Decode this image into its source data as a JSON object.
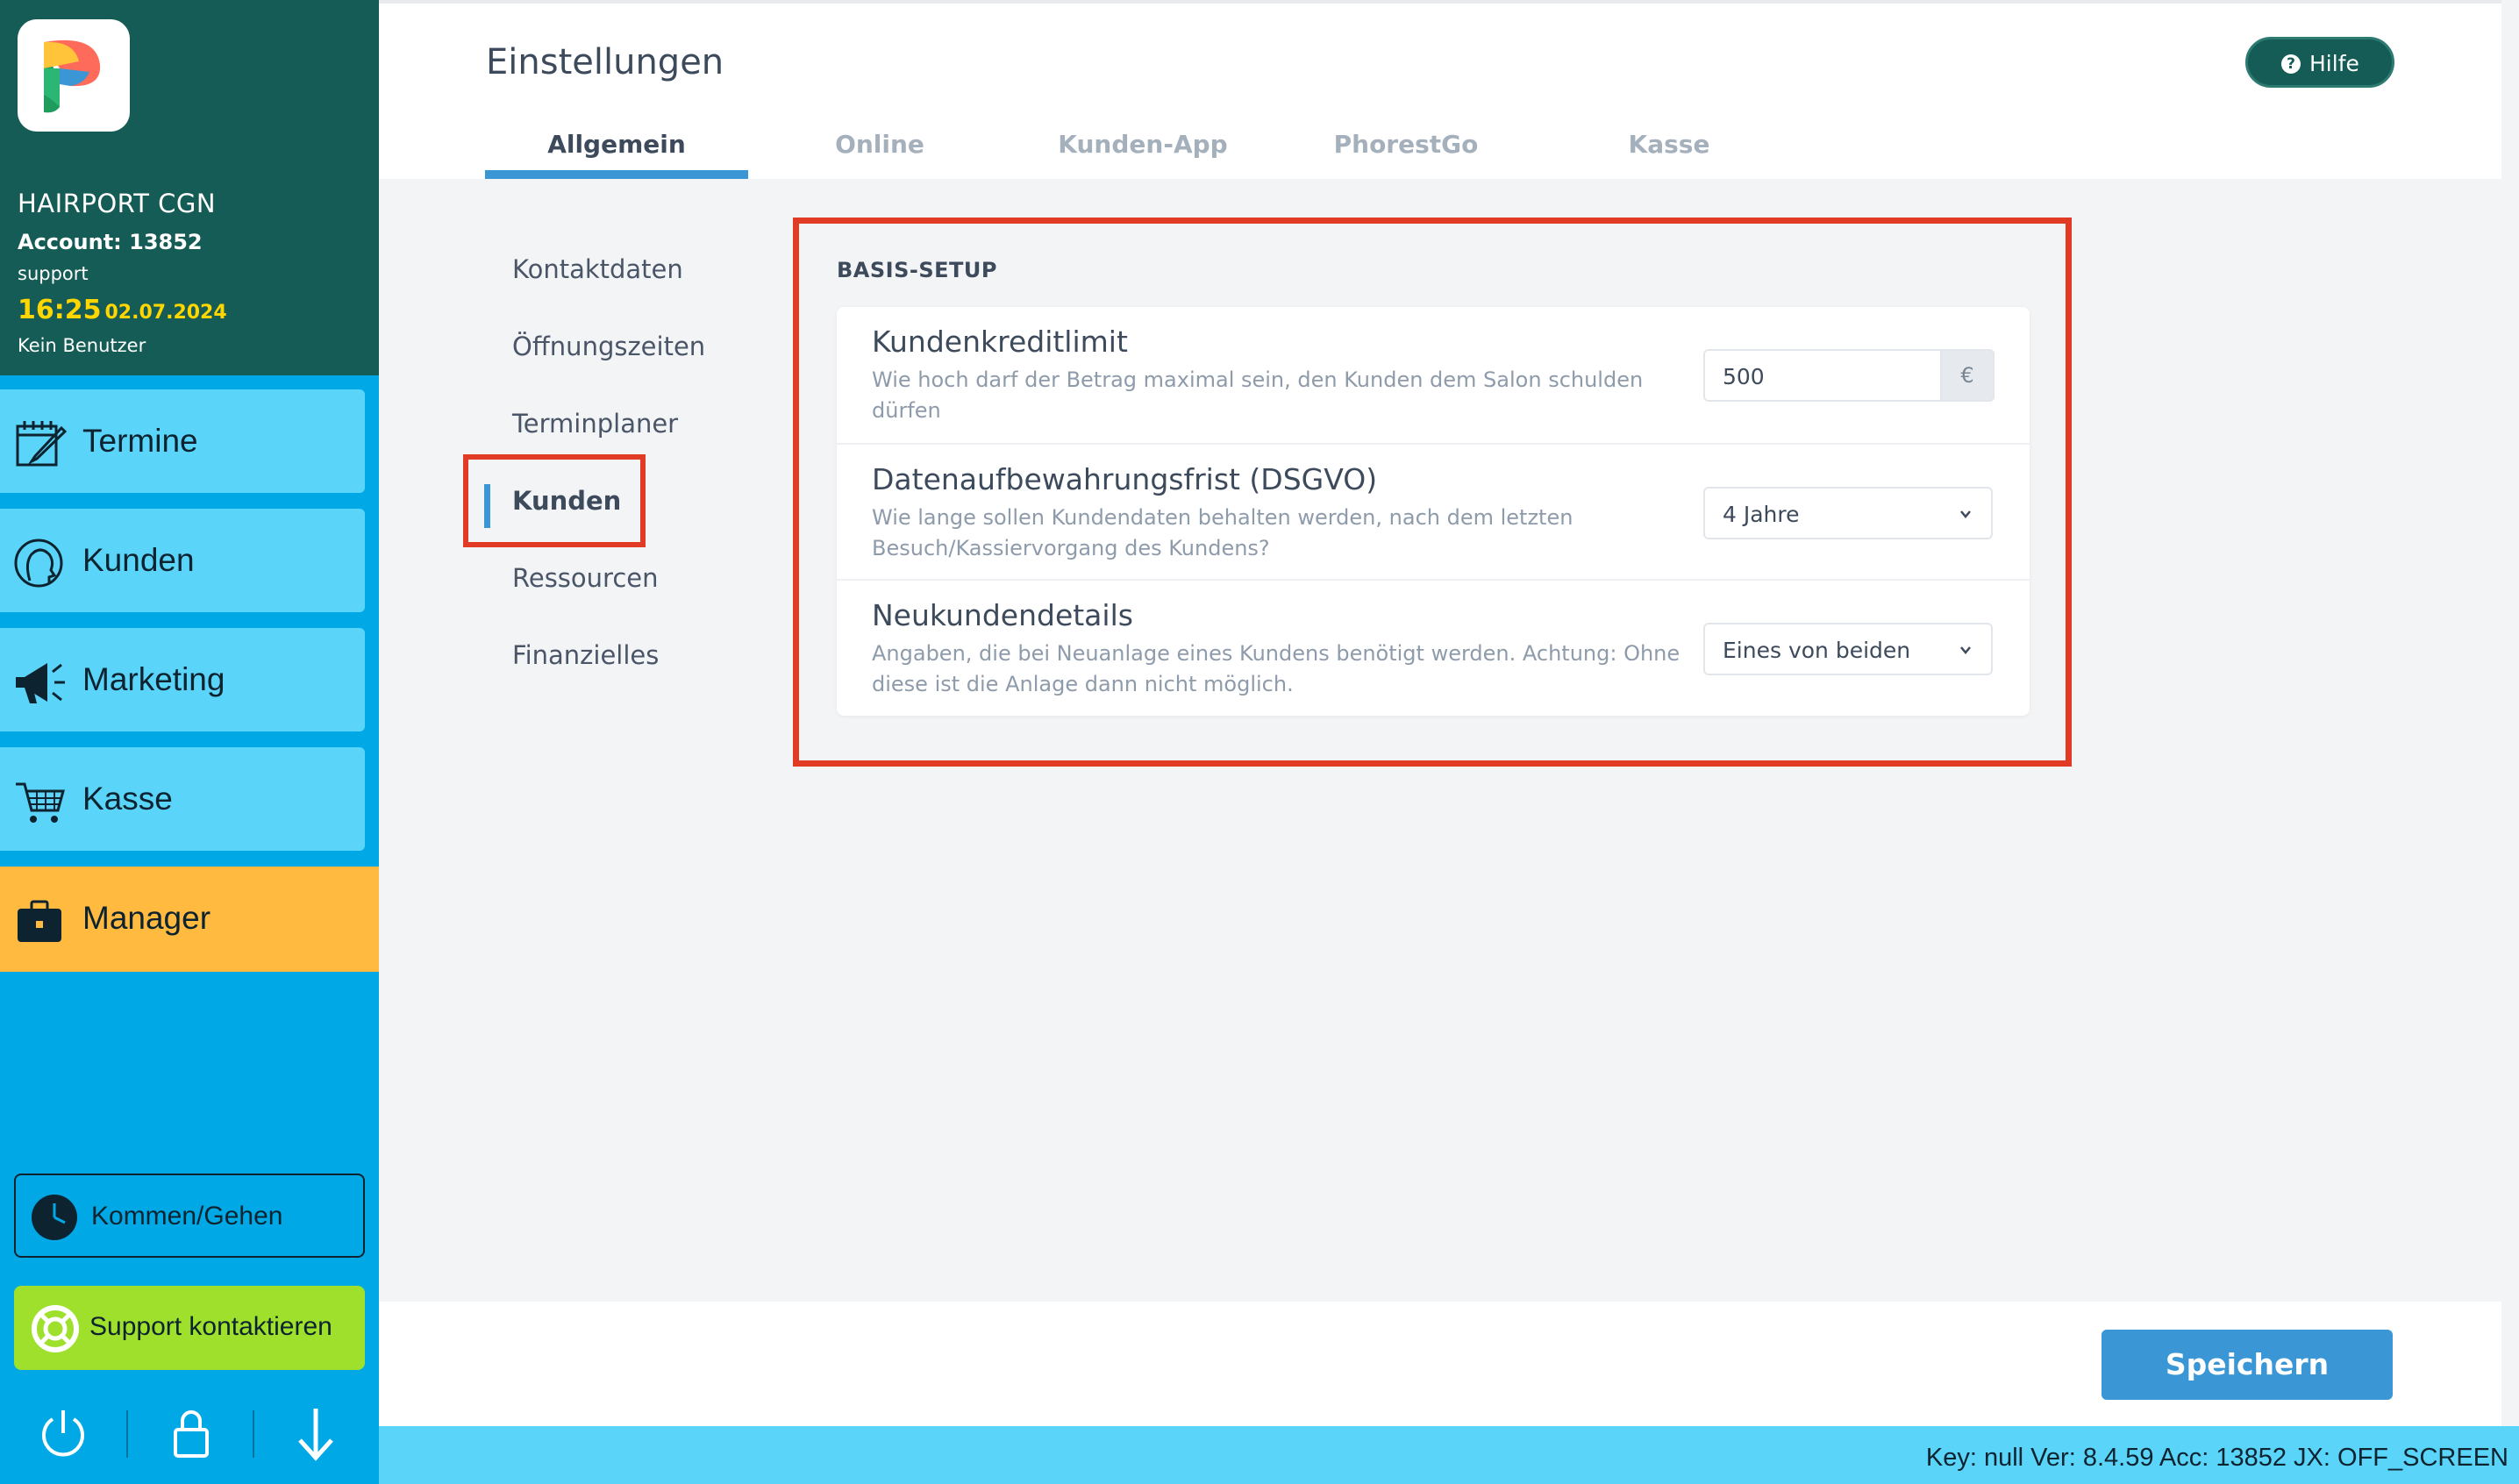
{
  "sidebar": {
    "salon_name": "HAIRPORT CGN",
    "account": "Account: 13852",
    "user": "support",
    "time": "16:25",
    "date": "02.07.2024",
    "no_user": "Kein Benutzer",
    "nav": [
      {
        "label": "Termine",
        "icon": "calendar-icon"
      },
      {
        "label": "Kunden",
        "icon": "customer-head-icon"
      },
      {
        "label": "Marketing",
        "icon": "megaphone-icon"
      },
      {
        "label": "Kasse",
        "icon": "cart-icon"
      },
      {
        "label": "Manager",
        "icon": "briefcase-icon"
      }
    ],
    "kommen_gehen": "Kommen/Gehen",
    "support": "Support kontaktieren",
    "colors": {
      "header": "#145c55",
      "nav": "#5ad5f9",
      "active": "#ffba3f",
      "support": "#9ee02b"
    }
  },
  "header": {
    "title": "Einstellungen",
    "help": "Hilfe",
    "tabs": [
      "Allgemein",
      "Online",
      "Kunden-App",
      "PhorestGo",
      "Kasse"
    ],
    "active_tab": "Allgemein"
  },
  "subnav": {
    "items": [
      "Kontaktdaten",
      "Öffnungszeiten",
      "Terminplaner",
      "Kunden",
      "Ressourcen",
      "Finanzielles"
    ],
    "active": "Kunden"
  },
  "panel": {
    "section_title": "BASIS-SETUP",
    "rows": [
      {
        "title": "Kundenkreditlimit",
        "description": "Wie hoch darf der Betrag maximal sein, den Kunden dem Salon schulden dürfen",
        "value": "500",
        "addon": "€"
      },
      {
        "title": "Datenaufbewahrungsfrist (DSGVO)",
        "description": "Wie lange sollen Kundendaten behalten werden, nach dem letzten Besuch/Kassiervorgang des Kundens?",
        "value": "4 Jahre"
      },
      {
        "title": "Neukundendetails",
        "description": "Angaben, die bei Neuanlage eines Kundens benötigt werden. Achtung: Ohne diese ist die Anlage dann nicht möglich.",
        "value": "Eines von beiden"
      }
    ]
  },
  "footer": {
    "save": "Speichern",
    "status": "Key: null Ver: 8.4.59 Acc: 13852  JX: OFF_SCREEN"
  },
  "highlight_color": "#e13b26",
  "accent": "#3a96d4"
}
